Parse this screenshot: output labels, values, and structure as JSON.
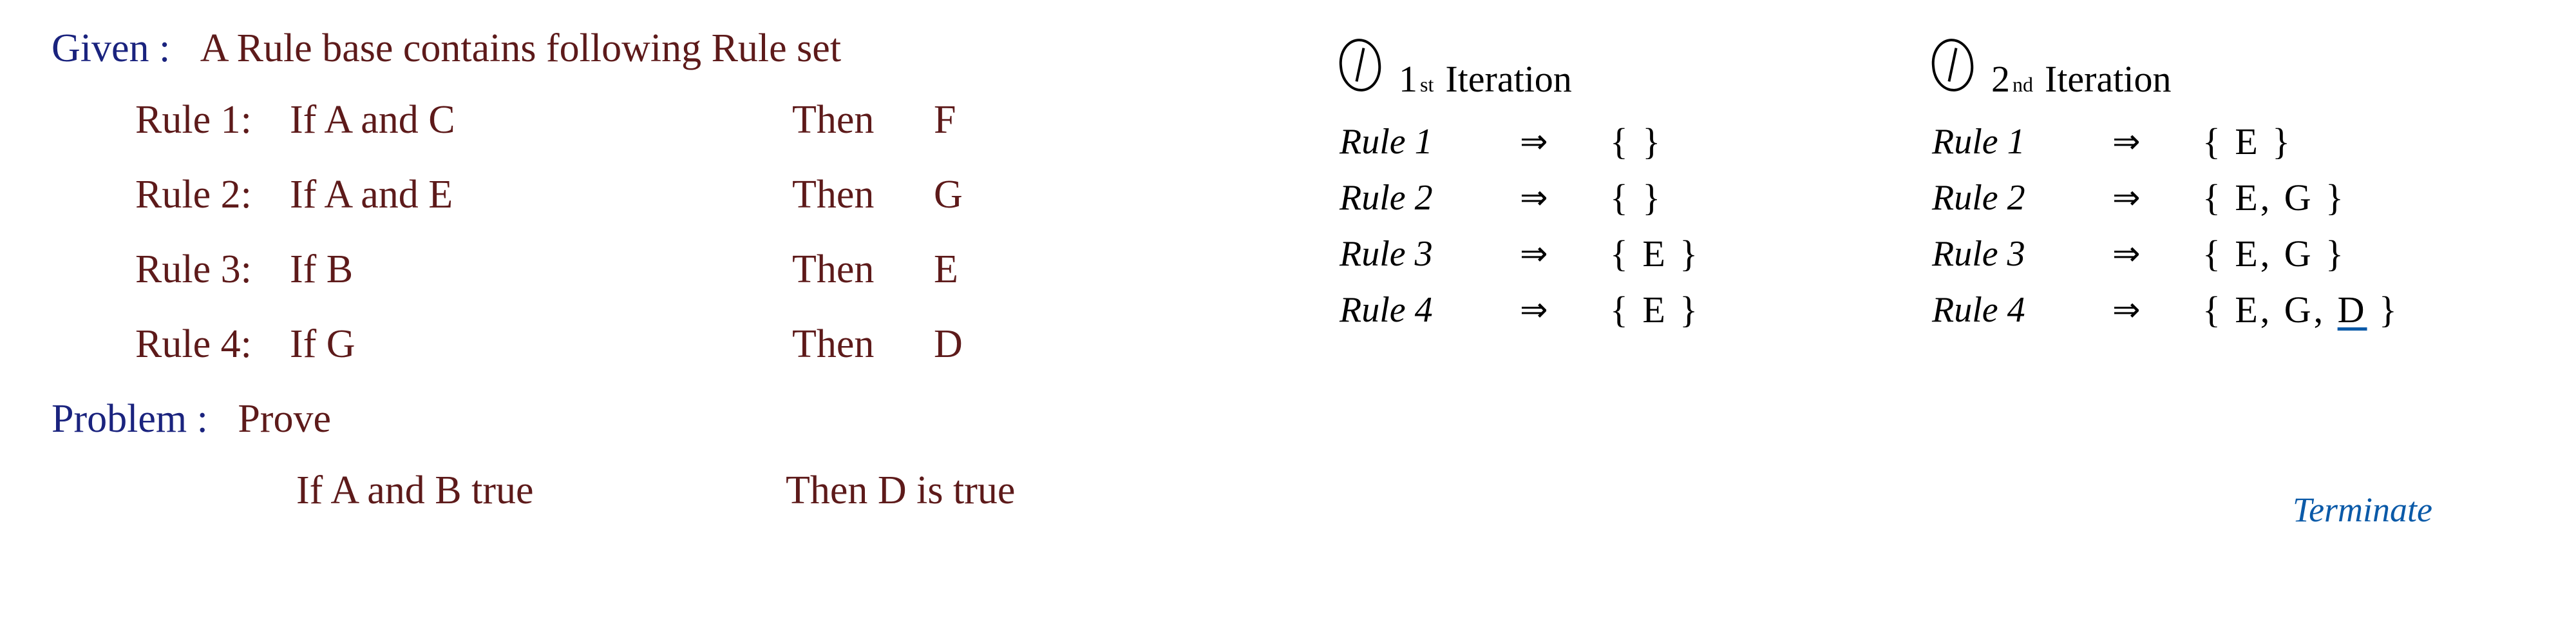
{
  "given": {
    "label": "Given :",
    "text": "A  Rule base  contains  following  Rule set"
  },
  "rules": [
    {
      "label": "Rule 1:",
      "if": "If  A and  C",
      "then": "Then",
      "result": "F"
    },
    {
      "label": "Rule 2:",
      "if": "If  A and  E",
      "then": "Then",
      "result": "G"
    },
    {
      "label": "Rule 3:",
      "if": "If  B",
      "then": "Then",
      "result": "E"
    },
    {
      "label": "Rule 4:",
      "if": "If  G",
      "then": "Then",
      "result": "D"
    }
  ],
  "problem": {
    "label": "Problem :",
    "text": "Prove",
    "prove_if": "If  A and B true",
    "prove_then": "Then D is true"
  },
  "iterations": [
    {
      "ordinal": "1",
      "sup": "st",
      "title": "Iteration",
      "rows": [
        {
          "rule": "Rule 1",
          "arrow": "⇒",
          "set": "{   }"
        },
        {
          "rule": "Rule 2",
          "arrow": "⇒",
          "set": "{   }"
        },
        {
          "rule": "Rule 3",
          "arrow": "⇒",
          "set": "{ E }"
        },
        {
          "rule": "Rule 4",
          "arrow": "⇒",
          "set": "{ E }"
        }
      ]
    },
    {
      "ordinal": "2",
      "sup": "nd",
      "title": "Iteration",
      "rows": [
        {
          "rule": "Rule 1",
          "arrow": "⇒",
          "set": "{ E }"
        },
        {
          "rule": "Rule 2",
          "arrow": "⇒",
          "set": "{ E, G }"
        },
        {
          "rule": "Rule 3",
          "arrow": "⇒",
          "set": "{ E, G }"
        },
        {
          "rule": "Rule 4",
          "arrow": "⇒",
          "set_prefix": "{ E, G, ",
          "set_d": "D",
          "set_suffix": " }"
        }
      ]
    }
  ],
  "terminate": "Terminate"
}
